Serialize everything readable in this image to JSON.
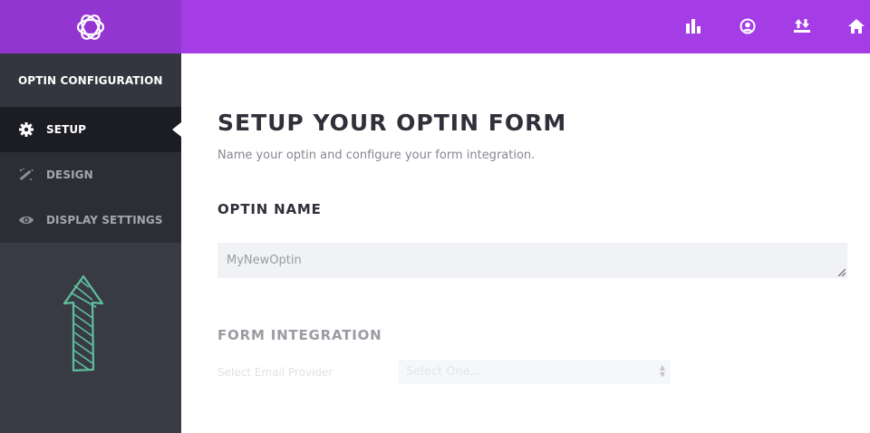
{
  "colors": {
    "topbar": "#a43de6",
    "logo_box": "#9235d1",
    "sidebar": "#393b44",
    "sidebar_active": "#1c1d22",
    "arrow_art": "#5fbf9b"
  },
  "header": {
    "logo_icon": "bloom-logo-icon",
    "icons": [
      "bar-chart-icon",
      "user-circle-icon",
      "import-export-icon",
      "home-icon"
    ]
  },
  "sidebar": {
    "title": "OPTIN CONFIGURATION",
    "items": [
      {
        "label": "SETUP",
        "icon": "gear-icon",
        "active": true
      },
      {
        "label": "DESIGN",
        "icon": "magic-wand-icon",
        "active": false
      },
      {
        "label": "DISPLAY SETTINGS",
        "icon": "eye-icon",
        "active": false
      }
    ]
  },
  "main": {
    "title": "SETUP YOUR OPTIN FORM",
    "subtitle": "Name your optin and configure your form integration.",
    "optin_name": {
      "label": "OPTIN NAME",
      "value": "MyNewOptin"
    },
    "form_integration": {
      "label": "FORM INTEGRATION",
      "provider_label": "Select Email Provider",
      "provider_value": "Select One..."
    }
  }
}
